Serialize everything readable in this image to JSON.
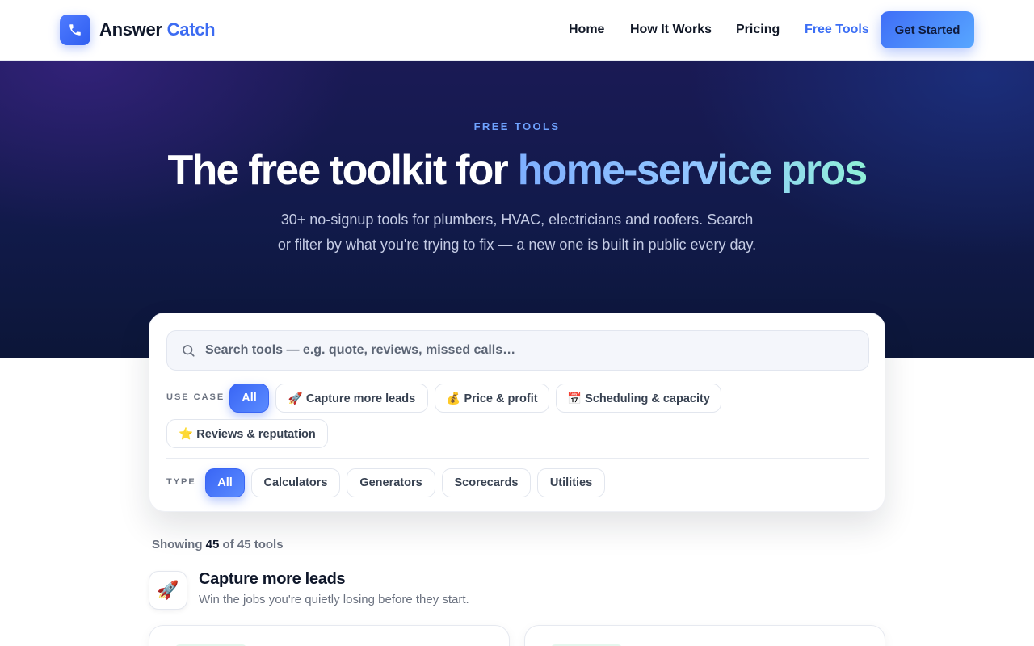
{
  "brand": {
    "name_part1": "Answer",
    "name_part2": "Catch",
    "logo_icon": "phone-icon"
  },
  "nav": {
    "items": [
      {
        "label": "Home"
      },
      {
        "label": "How It Works"
      },
      {
        "label": "Pricing"
      },
      {
        "label": "Free Tools",
        "active": true
      }
    ],
    "cta_label": "Get Started"
  },
  "hero": {
    "eyebrow": "FREE TOOLS",
    "title_plain": "The free toolkit for ",
    "title_highlight": "home-service pros",
    "subtitle": "30+ no-signup tools for plumbers, HVAC, electricians and roofers. Search or filter by what you're trying to fix — a new one is built in public every day."
  },
  "search": {
    "placeholder": "Search tools — e.g. quote, reviews, missed calls…",
    "value": "",
    "icon": "search-icon"
  },
  "filters": {
    "use_case_label": "USE CASE",
    "use_case_options": [
      {
        "label": "All",
        "active": true
      },
      {
        "label": "🚀 Capture more leads"
      },
      {
        "label": "💰 Price & profit"
      },
      {
        "label": "📅 Scheduling & capacity"
      },
      {
        "label": "⭐ Reviews & reputation"
      }
    ],
    "type_label": "TYPE",
    "type_options": [
      {
        "label": "All",
        "active": true
      },
      {
        "label": "Calculators"
      },
      {
        "label": "Generators"
      },
      {
        "label": "Scorecards"
      },
      {
        "label": "Utilities"
      }
    ]
  },
  "results": {
    "showing_prefix": "Showing",
    "shown_count": "45",
    "showing_mid": "of",
    "total_count": "45",
    "showing_suffix": "tools"
  },
  "section": {
    "icon": "🚀",
    "title": "Capture more leads",
    "subtitle": "Win the jobs you're quietly losing before they start."
  },
  "colors": {
    "accent": "#3b6ef5",
    "hero_bg": "#111a4a",
    "active_chip": "#3a66f5"
  }
}
